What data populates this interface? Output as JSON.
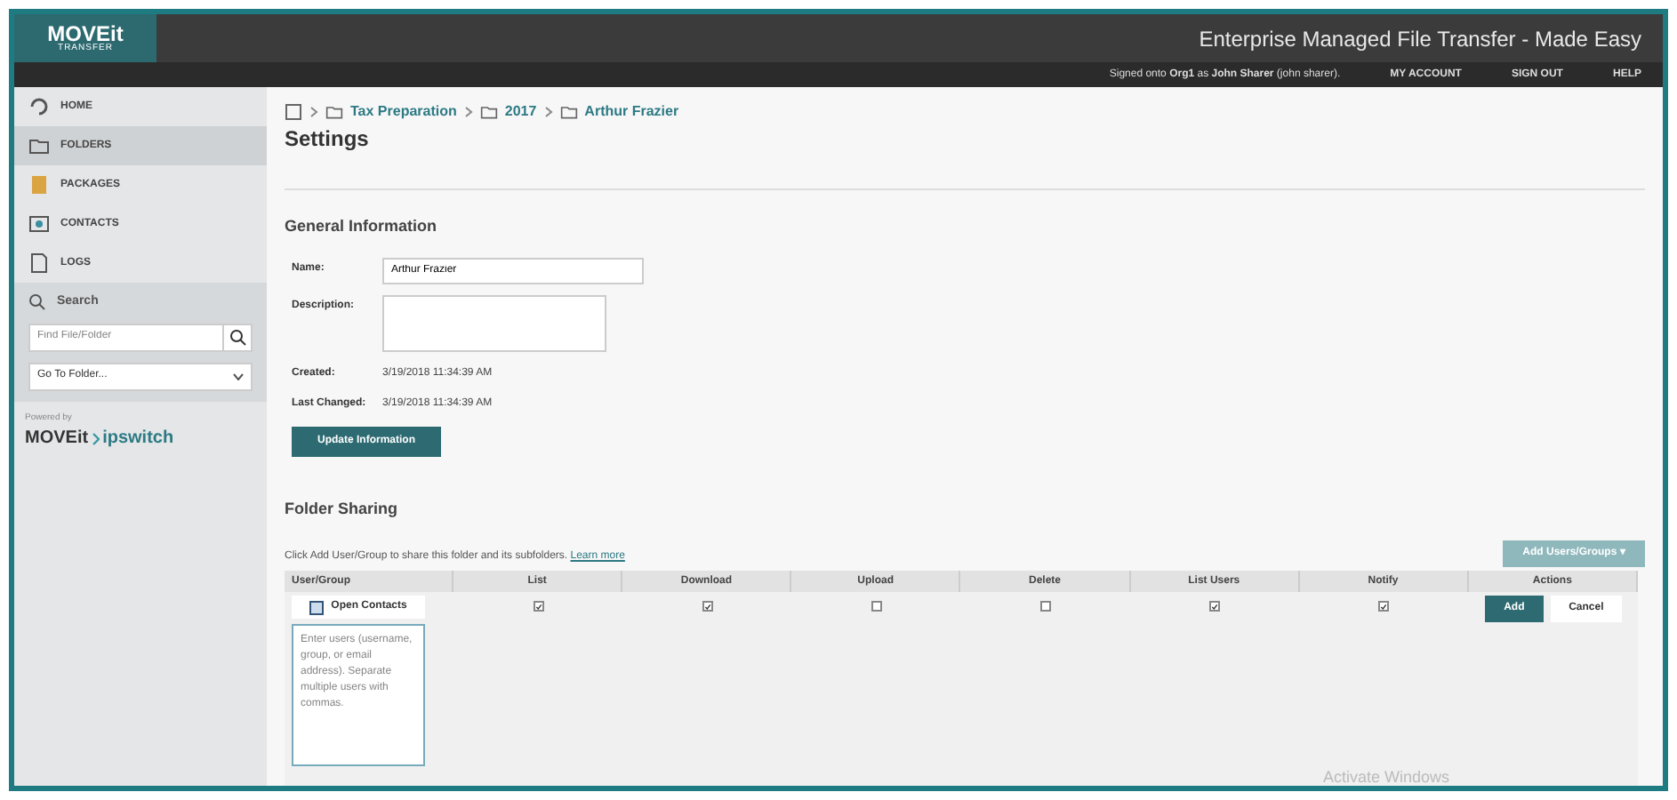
{
  "logo": {
    "name": "MOVEit",
    "sub": "TRANSFER"
  },
  "header": {
    "tagline": "Enterprise Managed File Transfer - Made Easy",
    "signed_in": "Signed onto **Org1** as **John Sharer** (john sharer).",
    "links": [
      "MY ACCOUNT",
      "SIGN OUT",
      "HELP"
    ]
  },
  "sidebar": {
    "items": [
      {
        "label": "HOME",
        "selected": false
      },
      {
        "label": "FOLDERS",
        "selected": true
      },
      {
        "label": "PACKAGES",
        "selected": false
      },
      {
        "label": "CONTACTS",
        "selected": false
      },
      {
        "label": "LOGS",
        "selected": false
      }
    ],
    "search": {
      "label": "Search",
      "placeholder": "Find File/Folder",
      "goto": "Go To Folder..."
    },
    "powered_by": "Powered by",
    "brand": [
      "MOVEit",
      "ipswitch"
    ]
  },
  "breadcrumb": [
    "Tax Preparation",
    "2017",
    "Arthur Frazier"
  ],
  "title": "Settings",
  "general": {
    "heading": "General Information",
    "fields": [
      {
        "label": "Name:",
        "kind": "input",
        "value": "Arthur Frazier"
      },
      {
        "label": "Description:",
        "kind": "textarea"
      },
      {
        "label": "Created:",
        "kind": "text",
        "value": "3/19/2018 11:34:39 AM"
      },
      {
        "label": "Last Changed:",
        "kind": "text",
        "value": "3/19/2018 11:34:39 AM"
      }
    ],
    "button": "Update Information"
  },
  "sharing": {
    "heading": "Folder Sharing",
    "hint": "Click Add User/Group to share this folder and its subfolders.",
    "link": "Learn more",
    "add_button": "Add Users/Groups ▾",
    "columns": [
      "User/Group",
      "List",
      "Download",
      "Upload",
      "Delete",
      "List Users",
      "Notify",
      "Actions"
    ],
    "open_contacts": "Open Contacts",
    "users_placeholder": "Enter users (username, group, or email address). Separate multiple users with commas.",
    "permissions": [
      {
        "checked": true
      },
      {
        "checked": true
      },
      {
        "checked": false
      },
      {
        "checked": false
      },
      {
        "checked": true
      },
      {
        "checked": true
      }
    ],
    "actions": [
      "Add",
      "Cancel"
    ]
  },
  "os_notice": "Activate Windows"
}
